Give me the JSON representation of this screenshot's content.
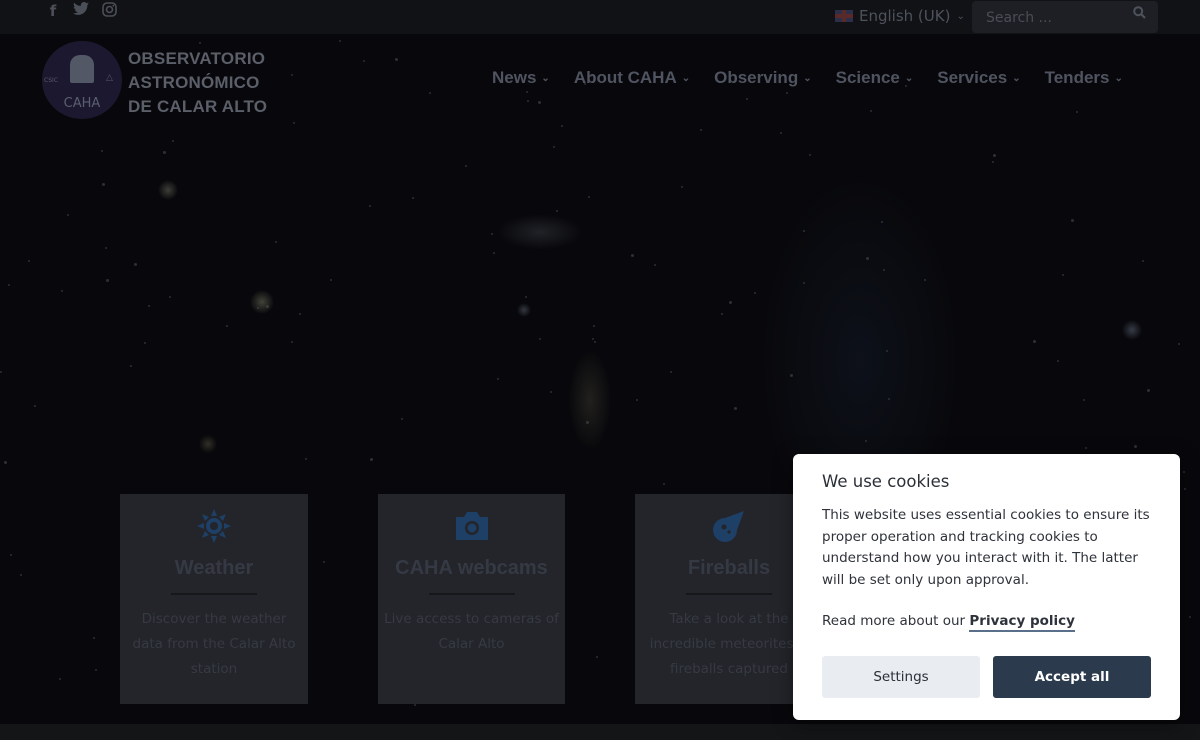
{
  "topbar": {
    "social": [
      {
        "icon": "facebook-icon",
        "glyph": "f"
      },
      {
        "icon": "twitter-icon",
        "glyph": "🐦"
      },
      {
        "icon": "instagram-icon",
        "glyph": "◎"
      }
    ],
    "language": "English (UK)",
    "search_placeholder": "Search ..."
  },
  "logo": {
    "badge_text": "CAHA",
    "badge_small": "CSIC",
    "lines": [
      "OBSERVATORIO",
      "ASTRONÓMICO",
      "DE CALAR ALTO"
    ]
  },
  "nav": {
    "items": [
      "News",
      "About CAHA",
      "Observing",
      "Science",
      "Services",
      "Tenders"
    ]
  },
  "cards": [
    {
      "title": "Weather",
      "desc": "Discover the weather data from the Calar Alto station",
      "icon": "sun-icon"
    },
    {
      "title": "CAHA webcams",
      "desc": "Live access to cameras of Calar Alto",
      "icon": "camera-icon"
    },
    {
      "title": "Fireballs",
      "desc": "Take a look at the incredible meteorites & fireballs captured",
      "icon": "meteor-icon"
    }
  ],
  "cookie": {
    "title": "We use cookies",
    "body": "This website uses essential cookies to ensure its proper operation and tracking cookies to understand how you interact with it. The latter will be set only upon approval.",
    "more_prefix": "Read more about our",
    "privacy_link": "Privacy policy",
    "settings_label": "Settings",
    "accept_label": "Accept all"
  },
  "colors": {
    "accent_blue": "#1e3f66",
    "button_dark": "#2c3a4e"
  }
}
